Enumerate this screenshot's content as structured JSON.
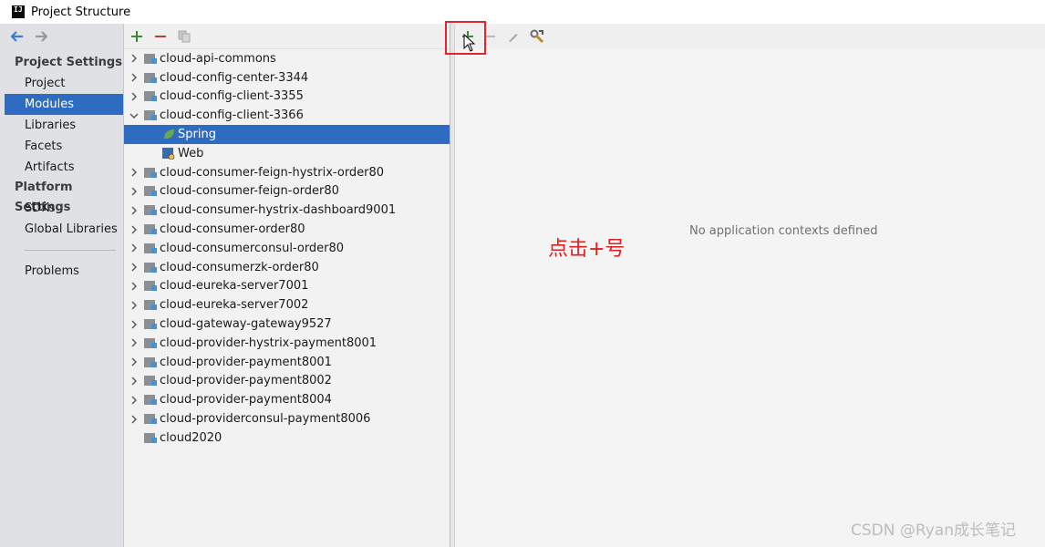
{
  "window": {
    "title": "Project Structure",
    "app_icon_text": "IJ"
  },
  "leftnav": {
    "project_settings_header": "Project Settings",
    "project_settings_items": [
      {
        "label": "Project",
        "selected": false
      },
      {
        "label": "Modules",
        "selected": true
      },
      {
        "label": "Libraries",
        "selected": false
      },
      {
        "label": "Facets",
        "selected": false
      },
      {
        "label": "Artifacts",
        "selected": false
      }
    ],
    "platform_settings_header": "Platform Settings",
    "platform_settings_items": [
      {
        "label": "SDKs"
      },
      {
        "label": "Global Libraries"
      }
    ],
    "problems_label": "Problems"
  },
  "modules": {
    "items": [
      {
        "label": "cloud-api-commons",
        "expanded": false
      },
      {
        "label": "cloud-config-center-3344",
        "expanded": false
      },
      {
        "label": "cloud-config-client-3355",
        "expanded": false
      },
      {
        "label": "cloud-config-client-3366",
        "expanded": true
      },
      {
        "label": "Spring",
        "child": true,
        "selected": true
      },
      {
        "label": "Web",
        "child": true
      },
      {
        "label": "cloud-consumer-feign-hystrix-order80"
      },
      {
        "label": "cloud-consumer-feign-order80"
      },
      {
        "label": "cloud-consumer-hystrix-dashboard9001"
      },
      {
        "label": "cloud-consumer-order80"
      },
      {
        "label": "cloud-consumerconsul-order80"
      },
      {
        "label": "cloud-consumerzk-order80"
      },
      {
        "label": "cloud-eureka-server7001"
      },
      {
        "label": "cloud-eureka-server7002"
      },
      {
        "label": "cloud-gateway-gateway9527"
      },
      {
        "label": "cloud-provider-hystrix-payment8001"
      },
      {
        "label": "cloud-provider-payment8001"
      },
      {
        "label": "cloud-provider-payment8002"
      },
      {
        "label": "cloud-provider-payment8004"
      },
      {
        "label": "cloud-providerconsul-payment8006"
      },
      {
        "label": "cloud2020",
        "no_chevron": true
      }
    ]
  },
  "right": {
    "empty_message": "No application contexts defined",
    "annotation": "点击+号"
  },
  "watermark": "CSDN @Ryan成长笔记",
  "colors": {
    "accent": "#2d6cc0",
    "add_green": "#3a8a3a",
    "remove_red": "#c23a3a",
    "annotation_red": "#e02020"
  }
}
